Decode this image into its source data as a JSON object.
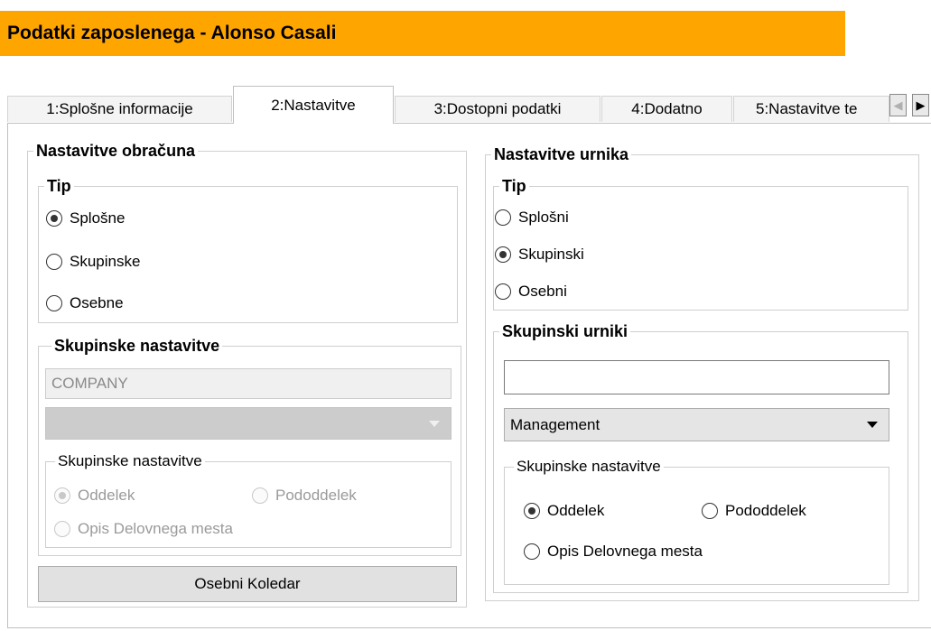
{
  "window": {
    "title": "Podatki zaposlenega - Alonso Casali"
  },
  "tabs": [
    {
      "label": "1:Splošne informacije",
      "active": false
    },
    {
      "label": "2:Nastavitve",
      "active": true
    },
    {
      "label": "3:Dostopni podatki",
      "active": false
    },
    {
      "label": "4:Dodatno",
      "active": false
    },
    {
      "label": "5:Nastavitve te",
      "active": false
    }
  ],
  "tab_scroll": {
    "left_icon": "◀",
    "right_icon": "▶"
  },
  "payroll": {
    "title": "Nastavitve obračuna",
    "type": {
      "title": "Tip",
      "options": [
        {
          "label": "Splošne",
          "checked": true
        },
        {
          "label": "Skupinske",
          "checked": false
        },
        {
          "label": "Osebne",
          "checked": false
        }
      ]
    },
    "group_settings": {
      "title": "Skupinske nastavitve",
      "input_value": "COMPANY",
      "select_value": "",
      "sub": {
        "title": "Skupinske nastavitve",
        "options": [
          {
            "label": "Oddelek",
            "checked": true
          },
          {
            "label": "Pododdelek",
            "checked": false
          },
          {
            "label": "Opis Delovnega mesta",
            "checked": false
          }
        ]
      }
    },
    "calendar_button": "Osebni Koledar"
  },
  "schedule": {
    "title": "Nastavitve urnika",
    "type": {
      "title": "Tip",
      "options": [
        {
          "label": "Splošni",
          "checked": false
        },
        {
          "label": "Skupinski",
          "checked": true
        },
        {
          "label": "Osebni",
          "checked": false
        }
      ]
    },
    "group_schedules": {
      "title": "Skupinski urniki",
      "input_value": "",
      "select_value": "Management",
      "sub": {
        "title": "Skupinske nastavitve",
        "options": [
          {
            "label": "Oddelek",
            "checked": true
          },
          {
            "label": "Pododdelek",
            "checked": false
          },
          {
            "label": "Opis Delovnega mesta",
            "checked": false
          }
        ]
      }
    }
  }
}
